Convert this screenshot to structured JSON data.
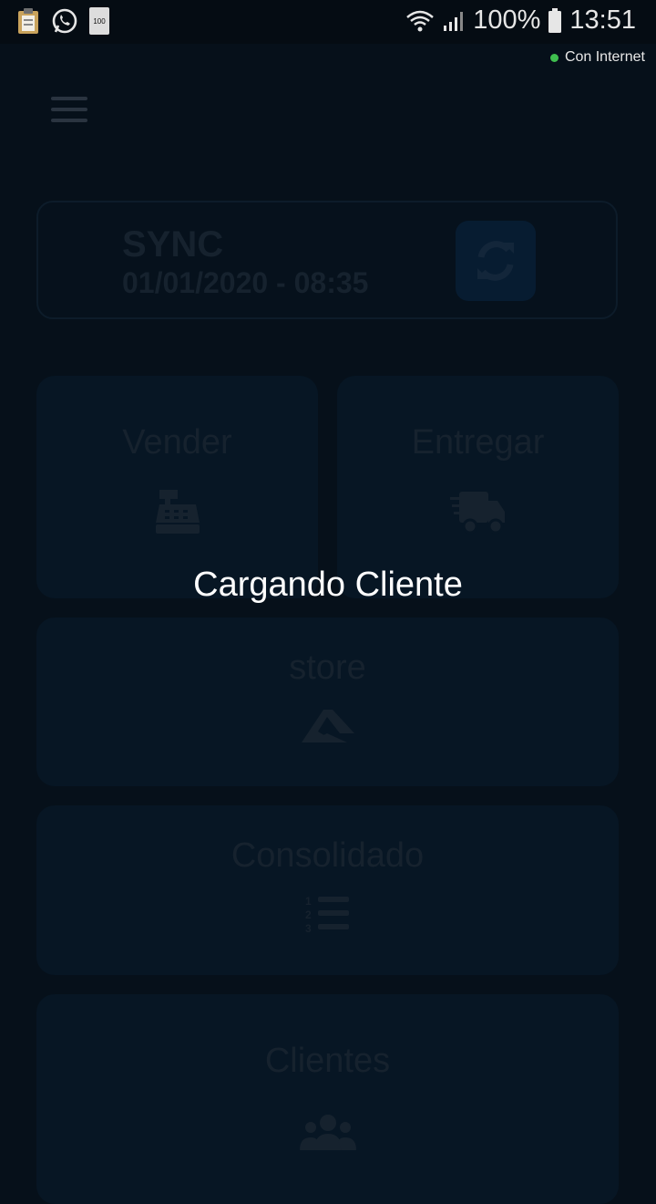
{
  "status_bar": {
    "battery_pct": "100%",
    "time": "13:51",
    "notification_badge": "100"
  },
  "connection": {
    "label": "Con Internet",
    "color": "#3fbf4f"
  },
  "sync": {
    "title": "SYNC",
    "date": "01/01/2020 - 08:35"
  },
  "tiles": {
    "vender": {
      "label": "Vender",
      "icon": "cash-register-icon"
    },
    "entregar": {
      "label": "Entregar",
      "icon": "delivery-truck-icon"
    },
    "store": {
      "label": "store",
      "icon": "store-logo-icon"
    },
    "consolidado": {
      "label": "Consolidado",
      "icon": "numbered-list-icon"
    },
    "clientes": {
      "label": "Clientes",
      "icon": "users-icon"
    }
  },
  "overlay": {
    "message": "Cargando Cliente"
  },
  "colors": {
    "background": "#06101a",
    "tile": "#071624",
    "dimmed_text": "#16222e"
  }
}
